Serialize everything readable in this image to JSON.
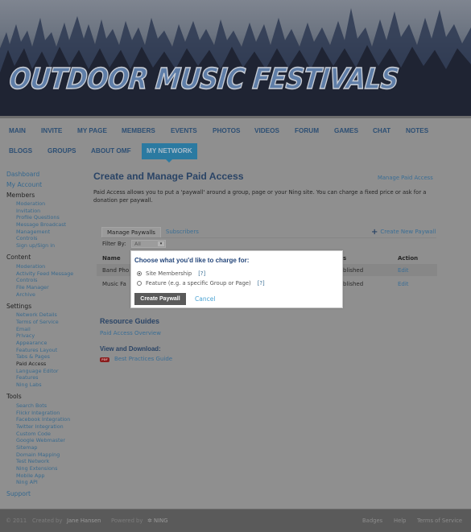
{
  "banner": {
    "title": "OUTDOOR MUSIC FESTIVALS"
  },
  "nav": {
    "row1": [
      "MAIN",
      "INVITE",
      "MY PAGE",
      "MEMBERS",
      "EVENTS",
      "PHOTOS",
      "VIDEOS",
      "FORUM",
      "GAMES",
      "CHAT",
      "NOTES"
    ],
    "row2": [
      "BLOGS",
      "GROUPS",
      "ABOUT OMF",
      "MY NETWORK"
    ],
    "active": "MY NETWORK"
  },
  "sidebar": {
    "dashboard": "Dashboard",
    "my_account": "My Account",
    "members": {
      "heading": "Members",
      "items": [
        "Moderation",
        "Invitation",
        "Profile Questions",
        "Message Broadcast",
        "Management",
        "Controls",
        "Sign up/Sign in"
      ]
    },
    "content": {
      "heading": "Content",
      "items": [
        "Moderation",
        "Activity Feed Message",
        "Controls",
        "File Manager",
        "Archive"
      ]
    },
    "settings": {
      "heading": "Settings",
      "items": [
        "Network Details",
        "Terms of Service",
        "Email",
        "Privacy",
        "Appearance",
        "Features Layout",
        "Tabs & Pages",
        "Paid Access",
        "Language Editor",
        "Features",
        "Ning Labs"
      ],
      "current": "Paid Access"
    },
    "tools": {
      "heading": "Tools",
      "items": [
        "Search Bots",
        "Flickr Integration",
        "Facebook Integration",
        "Twitter Integration",
        "Custom Code",
        "Google Webmaster",
        "Sitemap",
        "Domain Mapping",
        "Test Network",
        "Ning Extensions",
        "Mobile App",
        "Ning API"
      ]
    },
    "support": "Support"
  },
  "main": {
    "title": "Create and Manage Paid Access",
    "manage_link": "Manage Paid Access",
    "intro": "Paid Access allows you to put a 'paywall' around a group, page or your Ning site. You can charge a fixed price or ask for a donation per paywall.",
    "tabs": [
      "Manage Paywalls",
      "Subscribers"
    ],
    "create_new": "Create New Paywall",
    "filter_label": "Filter By:",
    "filter_value": "All",
    "table": {
      "headers": {
        "name": "Name",
        "status": "s",
        "action": "Action"
      },
      "rows": [
        {
          "name": "Band Pho",
          "status": "blished",
          "action": "Edit"
        },
        {
          "name": "Music Fa",
          "status": "blished",
          "action": "Edit"
        }
      ]
    },
    "resources": {
      "title": "Resource Guides",
      "overview_link": "Paid Access Overview",
      "download_title": "View and Download:",
      "pdf_label": "PDF",
      "guide_link": "Best Practices Guide"
    }
  },
  "dialog": {
    "title": "Choose what you'd like to charge for:",
    "options": [
      {
        "label": "Site Membership",
        "help": "[?]",
        "checked": true
      },
      {
        "label": "Feature (e.g. a specific Group or Page)",
        "help": "[?]",
        "checked": false
      }
    ],
    "create_button": "Create Paywall",
    "cancel": "Cancel"
  },
  "footer": {
    "copyright": "© 2011",
    "created_by": "Created by",
    "author": "Jane Hansen",
    "powered_by": "Powered by",
    "ning": "NING",
    "links": [
      "Badges",
      "Help",
      "Terms of Service"
    ]
  }
}
